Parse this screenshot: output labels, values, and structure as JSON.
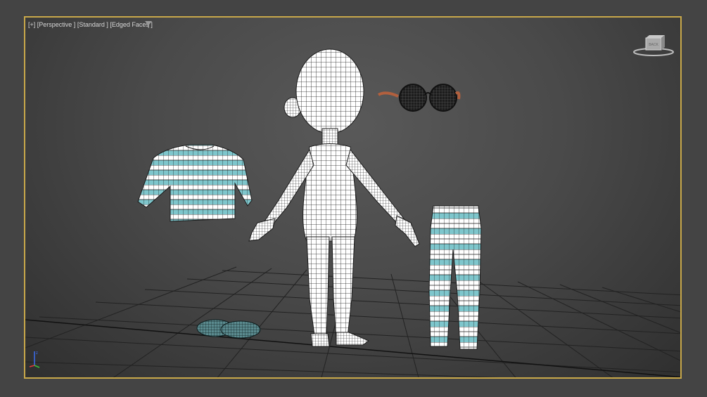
{
  "viewport": {
    "labels": [
      "[+]",
      "[Perspective ]",
      "[Standard ]",
      "[Edged Faces ]"
    ]
  },
  "icons": {
    "filter": "filter-icon",
    "viewcube": "viewcube-icon",
    "axis": "axis-gizmo-icon"
  },
  "colors": {
    "viewport_border": "#c8a84a",
    "mesh_white": "#ffffff",
    "cloth_teal": "#7ec6cc",
    "wire": "#1a1a1a"
  }
}
